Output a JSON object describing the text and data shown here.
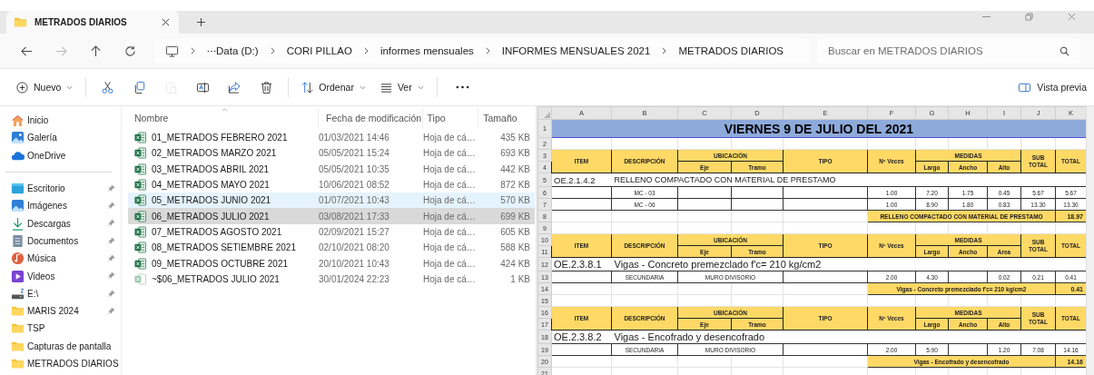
{
  "tabs": [
    {
      "title": "METRADOS DIARIOS",
      "selected": true
    }
  ],
  "nav": [
    {
      "kind": "back",
      "disabled": false
    },
    {
      "kind": "forward",
      "disabled": true
    },
    {
      "kind": "up",
      "disabled": false
    },
    {
      "kind": "refresh",
      "disabled": false
    }
  ],
  "address": {
    "crumbs": [
      "Data (D:)",
      "CORI PILLAO",
      "informes mensuales",
      "INFORMES MENSUALES 2021",
      "METRADOS DIARIOS"
    ]
  },
  "search": {
    "placeholder": "Buscar en METRADOS DIARIOS"
  },
  "toolbar": {
    "new_label": "Nuevo",
    "actions": [
      {
        "kind": "cut",
        "disabled": false
      },
      {
        "kind": "copy",
        "disabled": false
      },
      {
        "kind": "paste",
        "disabled": true
      },
      {
        "kind": "rename",
        "disabled": false
      },
      {
        "kind": "share",
        "disabled": false
      },
      {
        "kind": "delete",
        "disabled": false
      }
    ],
    "sort_label": "Ordenar",
    "view_label": "Ver",
    "preview_label": "Vista previa"
  },
  "sidebar": {
    "top_items": [
      {
        "label": "Inicio",
        "kind": "home"
      },
      {
        "label": "Galería",
        "kind": "gallery"
      },
      {
        "label": "OneDrive",
        "kind": "cloud"
      }
    ],
    "quick_access": [
      {
        "label": "Escritorio",
        "kind": "desktop",
        "pinned": true
      },
      {
        "label": "Imágenes",
        "kind": "pictures",
        "pinned": true
      },
      {
        "label": "Descargas",
        "kind": "download",
        "pinned": true
      },
      {
        "label": "Documentos",
        "kind": "documents",
        "pinned": true
      },
      {
        "label": "Música",
        "kind": "music",
        "pinned": true
      },
      {
        "label": "Videos",
        "kind": "videos",
        "pinned": true
      },
      {
        "label": "E:\\",
        "kind": "drive",
        "pinned": true
      },
      {
        "label": "MARIS 2024",
        "kind": "folder",
        "pinned": true
      },
      {
        "label": "TSP",
        "kind": "folder",
        "pinned": false
      },
      {
        "label": "Capturas de pantalla",
        "kind": "folder",
        "pinned": false
      },
      {
        "label": "METRADOS DIARIOS",
        "kind": "folder",
        "pinned": false
      }
    ]
  },
  "files": {
    "columns": [
      "Nombre",
      "Fecha de modificación",
      "Tipo",
      "Tamaño"
    ],
    "rows": [
      {
        "name": "01_METRADOS FEBRERO 2021",
        "modified": "01/03/2021 14:46",
        "type": "Hoja de cá…",
        "size": "435 KB",
        "kind": "excel",
        "hovered": false,
        "selected": false
      },
      {
        "name": "02_METRADOS MARZO 2021",
        "modified": "05/05/2021 15:24",
        "type": "Hoja de cá…",
        "size": "693 KB",
        "kind": "excel",
        "hovered": false,
        "selected": false
      },
      {
        "name": "03_METRADOS ABRIL 2021",
        "modified": "05/05/2021 10:35",
        "type": "Hoja de cá…",
        "size": "442 KB",
        "kind": "excel",
        "hovered": false,
        "selected": false
      },
      {
        "name": "04_METRADOS MAYO 2021",
        "modified": "10/06/2021 08:52",
        "type": "Hoja de cá…",
        "size": "872 KB",
        "kind": "excel",
        "hovered": false,
        "selected": false
      },
      {
        "name": "05_METRADOS JUNIO 2021",
        "modified": "01/07/2021 10:43",
        "type": "Hoja de cá…",
        "size": "570 KB",
        "kind": "excel",
        "hovered": true,
        "selected": false
      },
      {
        "name": "06_METRADOS JULIO 2021",
        "modified": "03/08/2021 17:33",
        "type": "Hoja de cá…",
        "size": "699 KB",
        "kind": "excel",
        "hovered": false,
        "selected": true
      },
      {
        "name": "07_METRADOS AGOSTO 2021",
        "modified": "02/09/2021 15:27",
        "type": "Hoja de cá…",
        "size": "605 KB",
        "kind": "excel",
        "hovered": false,
        "selected": false
      },
      {
        "name": "08_METRADOS SETIEMBRE 2021",
        "modified": "02/10/2021 08:20",
        "type": "Hoja de cá…",
        "size": "588 KB",
        "kind": "excel",
        "hovered": false,
        "selected": false
      },
      {
        "name": "09_METRADOS OCTUBRE 2021",
        "modified": "20/10/2021 10:43",
        "type": "Hoja de cá…",
        "size": "424 KB",
        "kind": "excel",
        "hovered": false,
        "selected": false
      },
      {
        "name": "~$06_METRADOS JULIO 2021",
        "modified": "30/01/2024 22:23",
        "type": "Hoja de cá…",
        "size": "1 KB",
        "kind": "temp",
        "hovered": false,
        "selected": false
      }
    ]
  },
  "sheet": {
    "columns": [
      "A",
      "B",
      "C",
      "D",
      "E",
      "F",
      "G",
      "H",
      "I",
      "J",
      "K"
    ],
    "rows": [
      {
        "kind": "title",
        "number": "1",
        "text": "VIERNES 9 DE JULIO DEL 2021"
      },
      {
        "kind": "blank",
        "number": "2"
      },
      {
        "kind": "header",
        "numbers": [
          "3",
          "4"
        ],
        "item": "ITEM",
        "description": "DESCRIPCIÓN",
        "location": "UBICACIÓN",
        "axis": "Eje",
        "section": "Tramo",
        "type": "TIPO",
        "times": "Nº Veces",
        "measures": "MEDIDAS",
        "length": "Largo",
        "width": "Ancho",
        "third": "Alto",
        "subtotal": "SUB TOTAL",
        "total": "TOTAL"
      },
      {
        "kind": "item",
        "number": "5",
        "code": "OE.2.1.4.2",
        "text": "RELLENO COMPACTADO CON MATERIAL DE PRESTAMO",
        "large": false
      },
      {
        "kind": "detail",
        "number": "6",
        "cells": {
          "B": "MC - 03",
          "F": "1.00",
          "G": "7.20",
          "H": "1.75",
          "I": "0.45",
          "J": "5.67",
          "K": "5.67"
        }
      },
      {
        "kind": "detail",
        "number": "7",
        "cells": {
          "B": "MC - 06",
          "F": "1.00",
          "G": "8.90",
          "H": "1.80",
          "I": "0.83",
          "J": "13.30",
          "K": "13.30"
        }
      },
      {
        "kind": "total",
        "number": "8",
        "label": "RELLENO COMPACTADO CON MATERIAL DE PRESTAMO",
        "value": "18.97"
      },
      {
        "kind": "blank",
        "number": "9"
      },
      {
        "kind": "header",
        "numbers": [
          "10",
          "11"
        ],
        "item": "ITEM",
        "description": "DESCRIPCIÓN",
        "location": "UBICACIÓN",
        "axis": "Eje",
        "section": "Tramo",
        "type": "TIPO",
        "times": "Nº Veces",
        "measures": "MEDIDAS",
        "length": "Largo",
        "width": "Ancho",
        "third": "Area",
        "subtotal": "SUB TOTAL",
        "total": "TOTAL"
      },
      {
        "kind": "item",
        "number": "12",
        "code": "OE.2.3.8.1",
        "text": "Vigas - Concreto premezclado f'c= 210 kg/cm2",
        "large": true
      },
      {
        "kind": "detail",
        "number": "13",
        "cells": {
          "B": "SECUNDARIA",
          "C:D": "MURO DIVISORIO",
          "F": "2.00",
          "G": "4.30",
          "I": "0.02",
          "J": "0.21",
          "K": "0.41"
        }
      },
      {
        "kind": "total",
        "number": "14",
        "label": "Vigas - Concreto premezclado f'c= 210 kg/cm2",
        "value": "0.41"
      },
      {
        "kind": "blank",
        "number": "15"
      },
      {
        "kind": "header",
        "numbers": [
          "16",
          "17"
        ],
        "item": "ITEM",
        "description": "DESCRIPCIÓN",
        "location": "UBICACIÓN",
        "axis": "Eje",
        "section": "Tramo",
        "type": "TIPO",
        "times": "Nº Veces",
        "measures": "MEDIDAS",
        "length": "Largo",
        "width": "Ancho",
        "third": "Alto",
        "subtotal": "SUB TOTAL",
        "total": "TOTAL"
      },
      {
        "kind": "item",
        "number": "18",
        "code": "OE.2.3.8.2",
        "text": "Vigas - Encofrado y desencofrado",
        "large": true
      },
      {
        "kind": "detail",
        "number": "19",
        "cells": {
          "B": "SECUNDARIA",
          "C:D": "MURO DIVISORIO",
          "F": "2.00",
          "G": "5.90",
          "I": "1.20",
          "J": "7.08",
          "K": "14.16"
        }
      },
      {
        "kind": "total",
        "number": "20",
        "label": "Vigas - Encofrado y desencofrado",
        "value": "14.16"
      },
      {
        "kind": "blank",
        "number": "21"
      }
    ]
  }
}
